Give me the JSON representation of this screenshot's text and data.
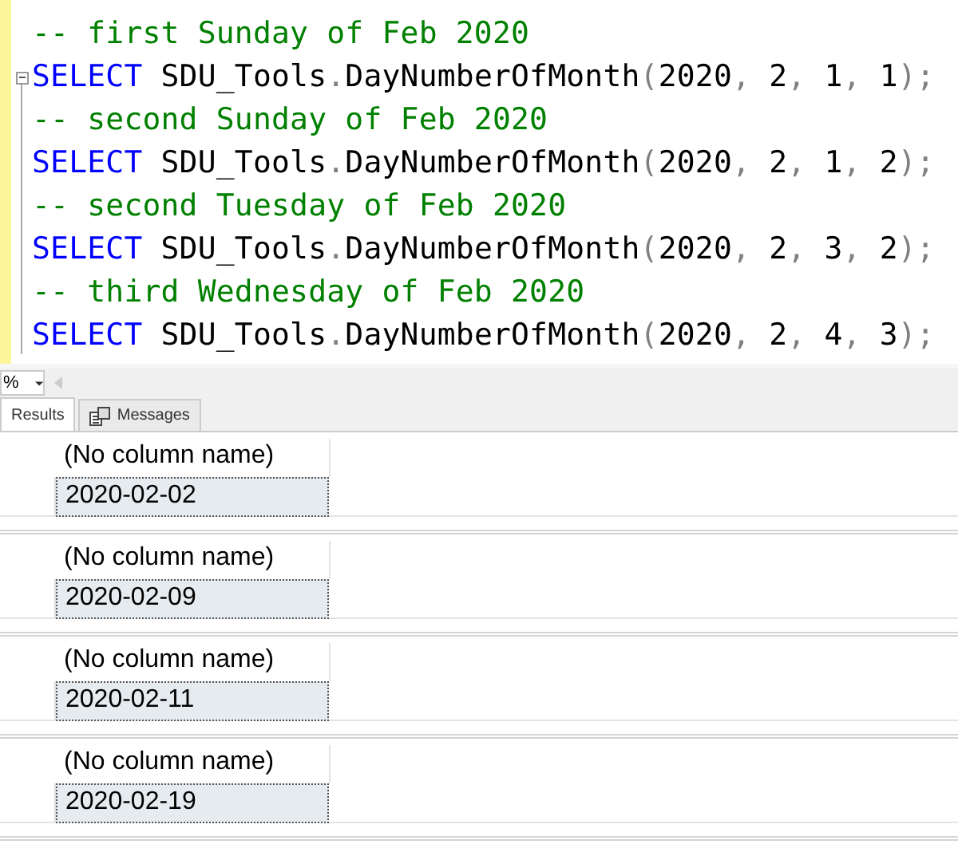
{
  "editor": {
    "lines": [
      {
        "collapsible": false,
        "tokens": [
          {
            "kind": "comment",
            "text": "-- first Sunday of Feb 2020"
          }
        ]
      },
      {
        "collapsible": true,
        "tokens": [
          {
            "kind": "keyword",
            "text": "SELECT"
          },
          {
            "kind": "plain",
            "text": " SDU_Tools"
          },
          {
            "kind": "punct",
            "text": "."
          },
          {
            "kind": "plain",
            "text": "DayNumberOfMonth"
          },
          {
            "kind": "punct",
            "text": "("
          },
          {
            "kind": "plain",
            "text": "2020"
          },
          {
            "kind": "punct",
            "text": ", "
          },
          {
            "kind": "plain",
            "text": "2"
          },
          {
            "kind": "punct",
            "text": ", "
          },
          {
            "kind": "plain",
            "text": "1"
          },
          {
            "kind": "punct",
            "text": ", "
          },
          {
            "kind": "plain",
            "text": "1"
          },
          {
            "kind": "punct",
            "text": ");"
          }
        ]
      },
      {
        "collapsible": false,
        "tokens": [
          {
            "kind": "comment",
            "text": "-- second Sunday of Feb 2020"
          }
        ]
      },
      {
        "collapsible": false,
        "tokens": [
          {
            "kind": "keyword",
            "text": "SELECT"
          },
          {
            "kind": "plain",
            "text": " SDU_Tools"
          },
          {
            "kind": "punct",
            "text": "."
          },
          {
            "kind": "plain",
            "text": "DayNumberOfMonth"
          },
          {
            "kind": "punct",
            "text": "("
          },
          {
            "kind": "plain",
            "text": "2020"
          },
          {
            "kind": "punct",
            "text": ", "
          },
          {
            "kind": "plain",
            "text": "2"
          },
          {
            "kind": "punct",
            "text": ", "
          },
          {
            "kind": "plain",
            "text": "1"
          },
          {
            "kind": "punct",
            "text": ", "
          },
          {
            "kind": "plain",
            "text": "2"
          },
          {
            "kind": "punct",
            "text": ");"
          }
        ]
      },
      {
        "collapsible": false,
        "tokens": [
          {
            "kind": "comment",
            "text": "-- second Tuesday of Feb 2020"
          }
        ]
      },
      {
        "collapsible": false,
        "tokens": [
          {
            "kind": "keyword",
            "text": "SELECT"
          },
          {
            "kind": "plain",
            "text": " SDU_Tools"
          },
          {
            "kind": "punct",
            "text": "."
          },
          {
            "kind": "plain",
            "text": "DayNumberOfMonth"
          },
          {
            "kind": "punct",
            "text": "("
          },
          {
            "kind": "plain",
            "text": "2020"
          },
          {
            "kind": "punct",
            "text": ", "
          },
          {
            "kind": "plain",
            "text": "2"
          },
          {
            "kind": "punct",
            "text": ", "
          },
          {
            "kind": "plain",
            "text": "3"
          },
          {
            "kind": "punct",
            "text": ", "
          },
          {
            "kind": "plain",
            "text": "2"
          },
          {
            "kind": "punct",
            "text": ");"
          }
        ]
      },
      {
        "collapsible": false,
        "tokens": [
          {
            "kind": "comment",
            "text": "-- third Wednesday of Feb 2020"
          }
        ]
      },
      {
        "collapsible": false,
        "tokens": [
          {
            "kind": "keyword",
            "text": "SELECT"
          },
          {
            "kind": "plain",
            "text": " SDU_Tools"
          },
          {
            "kind": "punct",
            "text": "."
          },
          {
            "kind": "plain",
            "text": "DayNumberOfMonth"
          },
          {
            "kind": "punct",
            "text": "("
          },
          {
            "kind": "plain",
            "text": "2020"
          },
          {
            "kind": "punct",
            "text": ", "
          },
          {
            "kind": "plain",
            "text": "2"
          },
          {
            "kind": "punct",
            "text": ", "
          },
          {
            "kind": "plain",
            "text": "4"
          },
          {
            "kind": "punct",
            "text": ", "
          },
          {
            "kind": "plain",
            "text": "3"
          },
          {
            "kind": "punct",
            "text": ");"
          }
        ]
      }
    ]
  },
  "zoom": {
    "value": "%"
  },
  "tabs": [
    {
      "label": "Results",
      "selected": true
    },
    {
      "label": "Messages",
      "selected": false
    }
  ],
  "results": [
    {
      "column": "(No column name)",
      "value": "2020-02-02"
    },
    {
      "column": "(No column name)",
      "value": "2020-02-09"
    },
    {
      "column": "(No column name)",
      "value": "2020-02-11"
    },
    {
      "column": "(No column name)",
      "value": "2020-02-19"
    }
  ]
}
